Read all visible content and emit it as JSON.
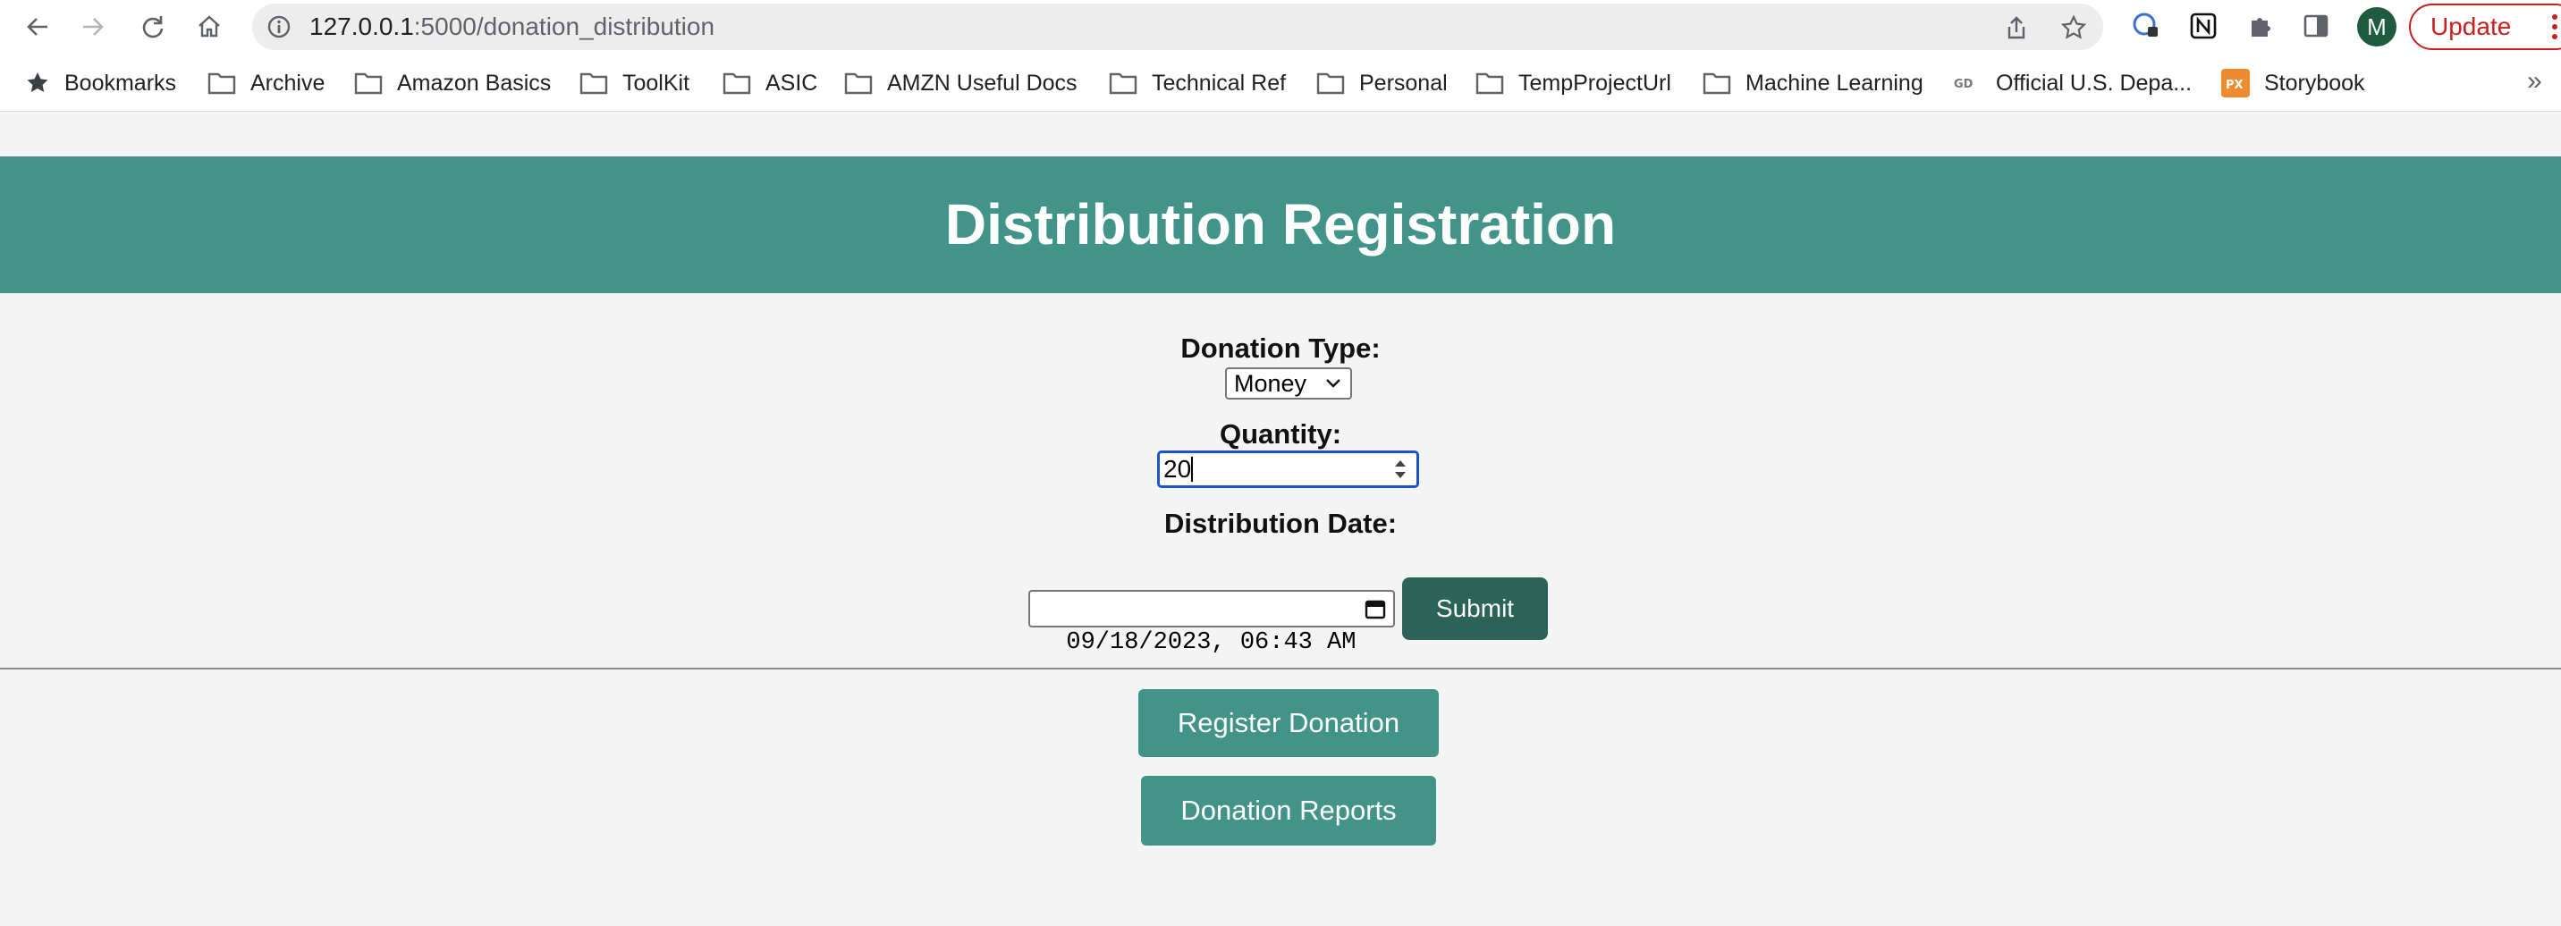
{
  "browser": {
    "url_host": "127.0.0.1",
    "url_path": ":5000/donation_distribution",
    "avatar_letter": "M",
    "update_label": "Update",
    "bookmarks": [
      {
        "label": "Bookmarks",
        "icon": "star-icon"
      },
      {
        "label": "Archive",
        "icon": "folder-icon"
      },
      {
        "label": "Amazon Basics",
        "icon": "folder-icon"
      },
      {
        "label": "ToolKit",
        "icon": "folder-icon"
      },
      {
        "label": "ASIC",
        "icon": "folder-icon"
      },
      {
        "label": "AMZN Useful Docs",
        "icon": "folder-icon"
      },
      {
        "label": "Technical Ref",
        "icon": "folder-icon"
      },
      {
        "label": "Personal",
        "icon": "folder-icon"
      },
      {
        "label": "TempProjectUrl",
        "icon": "folder-icon"
      },
      {
        "label": "Machine Learning",
        "icon": "folder-icon"
      },
      {
        "label": "Official U.S. Depa...",
        "icon": "gd-logo-icon"
      },
      {
        "label": "Storybook",
        "icon": "px-logo-icon"
      }
    ],
    "more_bookmarks": "»"
  },
  "page": {
    "title": "Distribution Registration",
    "header_color": "#429488",
    "form": {
      "donation_type_label": "Donation Type:",
      "donation_type_value": "Money",
      "quantity_label": "Quantity:",
      "quantity_value": "20",
      "date_label": "Distribution Date:",
      "date_value": "09/18/2023, 06:43 AM",
      "submit_label": "Submit"
    },
    "nav": {
      "register_label": "Register Donation",
      "reports_label": "Donation Reports"
    }
  }
}
